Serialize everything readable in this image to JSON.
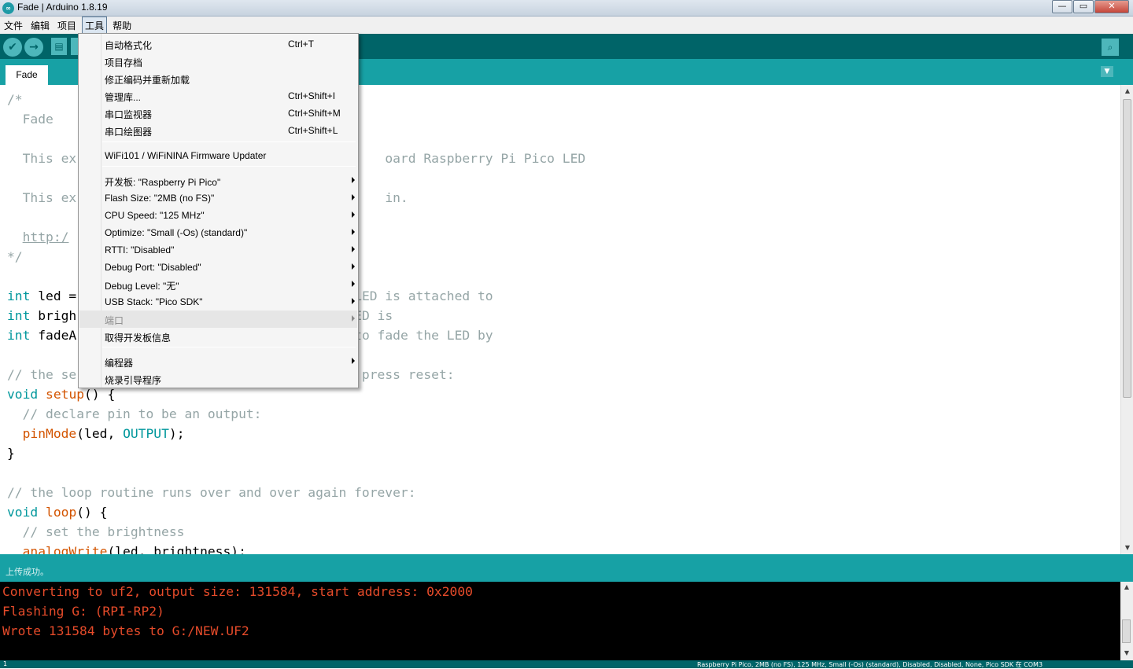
{
  "window": {
    "title": "Fade | Arduino 1.8.19",
    "app_icon": "arduino-logo-icon",
    "min_label": "—",
    "max_label": "▭",
    "close_label": "✕"
  },
  "menubar": {
    "items": [
      "文件",
      "编辑",
      "项目",
      "工具",
      "帮助"
    ],
    "active_index": 3
  },
  "toolbar": {
    "verify_icon": "✔",
    "upload_icon": "→",
    "new_icon": "▤",
    "serial_icon": "⌕"
  },
  "tabs": {
    "active": "Fade",
    "menu_icon": "▼"
  },
  "editor": {
    "lines": [
      {
        "segments": [
          {
            "t": "/*",
            "c": "c-com"
          }
        ]
      },
      {
        "segments": [
          {
            "t": "  Fade",
            "c": "c-com"
          }
        ]
      },
      {
        "segments": [
          {
            "t": "",
            "c": ""
          }
        ]
      },
      {
        "segments": [
          {
            "t": "  This ex",
            "c": "c-com"
          },
          {
            "t": "                                        ",
            "c": ""
          },
          {
            "t": "oard Raspberry Pi Pico LED",
            "c": "c-com"
          }
        ]
      },
      {
        "segments": [
          {
            "t": "",
            "c": ""
          }
        ]
      },
      {
        "segments": [
          {
            "t": "  This ex",
            "c": "c-com"
          },
          {
            "t": "                                        ",
            "c": ""
          },
          {
            "t": "in.",
            "c": "c-com"
          }
        ]
      },
      {
        "segments": [
          {
            "t": "",
            "c": ""
          }
        ]
      },
      {
        "segments": [
          {
            "t": "  ",
            "c": ""
          },
          {
            "t": "http:/",
            "c": "c-link"
          }
        ]
      },
      {
        "segments": [
          {
            "t": "*/",
            "c": "c-com"
          }
        ]
      },
      {
        "segments": [
          {
            "t": "",
            "c": ""
          }
        ]
      },
      {
        "segments": [
          {
            "t": "int",
            "c": "c-type"
          },
          {
            "t": " led =",
            "c": ""
          },
          {
            "t": "                                  ",
            "c": ""
          },
          {
            "t": "e LED is attached to",
            "c": "c-com"
          }
        ]
      },
      {
        "segments": [
          {
            "t": "int",
            "c": "c-type"
          },
          {
            "t": " brigh",
            "c": ""
          },
          {
            "t": "                                  ",
            "c": ""
          },
          {
            "t": " LED is",
            "c": "c-com"
          }
        ]
      },
      {
        "segments": [
          {
            "t": "int",
            "c": "c-type"
          },
          {
            "t": " fadeA",
            "c": ""
          },
          {
            "t": "                                  ",
            "c": ""
          },
          {
            "t": "s to fade the LED by",
            "c": "c-com"
          }
        ]
      },
      {
        "segments": [
          {
            "t": "",
            "c": ""
          }
        ]
      },
      {
        "segments": [
          {
            "t": "// the se",
            "c": "c-com"
          },
          {
            "t": "                                     ",
            "c": ""
          },
          {
            "t": "press reset:",
            "c": "c-com"
          }
        ]
      },
      {
        "segments": [
          {
            "t": "void",
            "c": "c-type"
          },
          {
            "t": " ",
            "c": ""
          },
          {
            "t": "setup",
            "c": "c-fn"
          },
          {
            "t": "() {",
            "c": ""
          }
        ]
      },
      {
        "segments": [
          {
            "t": "  // declare pin to be an output:",
            "c": "c-com"
          }
        ]
      },
      {
        "segments": [
          {
            "t": "  ",
            "c": ""
          },
          {
            "t": "pinMode",
            "c": "c-fn"
          },
          {
            "t": "(led, ",
            "c": ""
          },
          {
            "t": "OUTPUT",
            "c": "c-const"
          },
          {
            "t": ");",
            "c": ""
          }
        ]
      },
      {
        "segments": [
          {
            "t": "}",
            "c": ""
          }
        ]
      },
      {
        "segments": [
          {
            "t": "",
            "c": ""
          }
        ]
      },
      {
        "segments": [
          {
            "t": "// the loop routine runs over and over again forever:",
            "c": "c-com"
          }
        ]
      },
      {
        "segments": [
          {
            "t": "void",
            "c": "c-type"
          },
          {
            "t": " ",
            "c": ""
          },
          {
            "t": "loop",
            "c": "c-fn"
          },
          {
            "t": "() {",
            "c": ""
          }
        ]
      },
      {
        "segments": [
          {
            "t": "  // set the brightness",
            "c": "c-com"
          }
        ]
      },
      {
        "segments": [
          {
            "t": "  ",
            "c": ""
          },
          {
            "t": "analogWrite",
            "c": "c-fn"
          },
          {
            "t": "(led, brightness);",
            "c": ""
          }
        ]
      }
    ]
  },
  "status": {
    "text": "上传成功。"
  },
  "console": {
    "lines": [
      "Converting to uf2, output size: 131584, start address: 0x2000",
      "Flashing G: (RPI-RP2)",
      "Wrote 131584 bytes to G:/NEW.UF2"
    ]
  },
  "footer": {
    "line": "1",
    "board": "Raspberry Pi Pico, 2MB (no FS), 125 MHz, Small (-Os) (standard), Disabled, Disabled, None, Pico SDK 在 COM3"
  },
  "tools_menu": {
    "items": [
      {
        "label": "自动格式化",
        "shortcut": "Ctrl+T",
        "submenu": false,
        "disabled": false,
        "name": "menu-auto-format"
      },
      {
        "label": "项目存档",
        "shortcut": "",
        "submenu": false,
        "disabled": false,
        "name": "menu-archive-sketch"
      },
      {
        "label": "修正编码并重新加载",
        "shortcut": "",
        "submenu": false,
        "disabled": false,
        "name": "menu-fix-encoding"
      },
      {
        "label": "管理库...",
        "shortcut": "Ctrl+Shift+I",
        "submenu": false,
        "disabled": false,
        "name": "menu-manage-libraries"
      },
      {
        "label": "串口监视器",
        "shortcut": "Ctrl+Shift+M",
        "submenu": false,
        "disabled": false,
        "name": "menu-serial-monitor"
      },
      {
        "label": "串口绘图器",
        "shortcut": "Ctrl+Shift+L",
        "submenu": false,
        "disabled": false,
        "name": "menu-serial-plotter"
      },
      {
        "sep": true
      },
      {
        "label": "WiFi101 / WiFiNINA Firmware Updater",
        "shortcut": "",
        "submenu": false,
        "disabled": false,
        "name": "menu-wifi-updater"
      },
      {
        "sep": true
      },
      {
        "label": "开发板: \"Raspberry Pi Pico\"",
        "shortcut": "",
        "submenu": true,
        "disabled": false,
        "name": "menu-board"
      },
      {
        "label": "Flash Size: \"2MB (no FS)\"",
        "shortcut": "",
        "submenu": true,
        "disabled": false,
        "name": "menu-flash-size"
      },
      {
        "label": "CPU Speed: \"125 MHz\"",
        "shortcut": "",
        "submenu": true,
        "disabled": false,
        "name": "menu-cpu-speed"
      },
      {
        "label": "Optimize: \"Small (-Os) (standard)\"",
        "shortcut": "",
        "submenu": true,
        "disabled": false,
        "name": "menu-optimize"
      },
      {
        "label": "RTTI: \"Disabled\"",
        "shortcut": "",
        "submenu": true,
        "disabled": false,
        "name": "menu-rtti"
      },
      {
        "label": "Debug Port: \"Disabled\"",
        "shortcut": "",
        "submenu": true,
        "disabled": false,
        "name": "menu-debug-port"
      },
      {
        "label": "Debug Level: \"无\"",
        "shortcut": "",
        "submenu": true,
        "disabled": false,
        "name": "menu-debug-level"
      },
      {
        "label": "USB Stack: \"Pico SDK\"",
        "shortcut": "",
        "submenu": true,
        "disabled": false,
        "name": "menu-usb-stack"
      },
      {
        "label": "端口",
        "shortcut": "",
        "submenu": true,
        "disabled": true,
        "name": "menu-port"
      },
      {
        "label": "取得开发板信息",
        "shortcut": "",
        "submenu": false,
        "disabled": false,
        "name": "menu-board-info"
      },
      {
        "sep": true
      },
      {
        "label": "编程器",
        "shortcut": "",
        "submenu": true,
        "disabled": false,
        "name": "menu-programmer"
      },
      {
        "label": "烧录引导程序",
        "shortcut": "",
        "submenu": false,
        "disabled": false,
        "name": "menu-burn-bootloader"
      }
    ]
  },
  "colors": {
    "toolbar": "#006468",
    "tabbar": "#17a1a5",
    "comment": "#95a5a6",
    "keyword": "#00979c",
    "function": "#d35400",
    "console_text": "#e64b2a"
  }
}
